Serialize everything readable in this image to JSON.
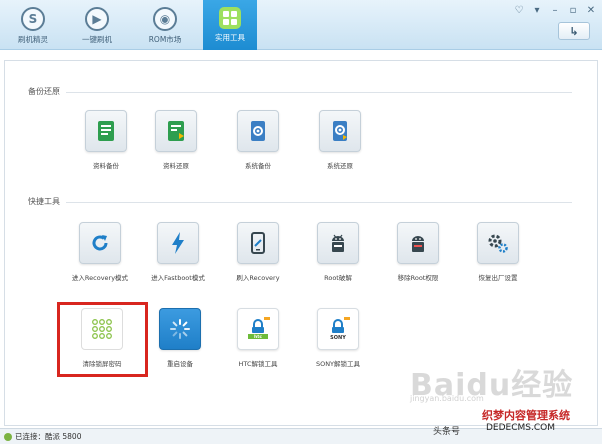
{
  "nav": {
    "tabs": [
      {
        "label": "刷机精灵",
        "icon": "s-logo-icon"
      },
      {
        "label": "一键刷机",
        "icon": "play-icon"
      },
      {
        "label": "ROM市场",
        "icon": "rom-market-icon"
      },
      {
        "label": "实用工具",
        "icon": "grid-icon",
        "active": true
      }
    ]
  },
  "backup": {
    "title": "备份还原",
    "items": [
      {
        "label": "资料备份",
        "icon": "data-backup-icon"
      },
      {
        "label": "资料还原",
        "icon": "data-restore-icon"
      },
      {
        "label": "系统备份",
        "icon": "system-backup-icon"
      },
      {
        "label": "系统还原",
        "icon": "system-restore-icon"
      }
    ]
  },
  "quick": {
    "title": "快捷工具",
    "row1": [
      {
        "label": "进入Recovery模式",
        "icon": "refresh-icon"
      },
      {
        "label": "进入Fastboot模式",
        "icon": "lightning-icon"
      },
      {
        "label": "刷入Recovery",
        "icon": "flash-recovery-icon"
      },
      {
        "label": "Root破解",
        "icon": "android-root-icon"
      },
      {
        "label": "移除Root权限",
        "icon": "android-unroot-icon"
      },
      {
        "label": "恢复出厂设置",
        "icon": "gears-icon"
      }
    ],
    "row2": [
      {
        "label": "清除锁屏密码",
        "icon": "pattern-lock-icon"
      },
      {
        "label": "重启设备",
        "icon": "reboot-spinner-icon"
      },
      {
        "label": "HTC解锁工具",
        "icon": "htc-unlock-icon",
        "brand": "htc"
      },
      {
        "label": "SONY解锁工具",
        "icon": "sony-unlock-icon",
        "brand": "SONY"
      }
    ]
  },
  "status": {
    "text": "已连接：酷派 5800"
  },
  "watermark": {
    "baidu": "Baidu经验",
    "jingyan": "jingyan.baidu.com",
    "brand": "织梦内容管理系统",
    "url": "DEDECMS.COM",
    "sub": "头条号"
  },
  "colors": {
    "accent": "#1d8cd2",
    "highlight": "#d8261f"
  }
}
